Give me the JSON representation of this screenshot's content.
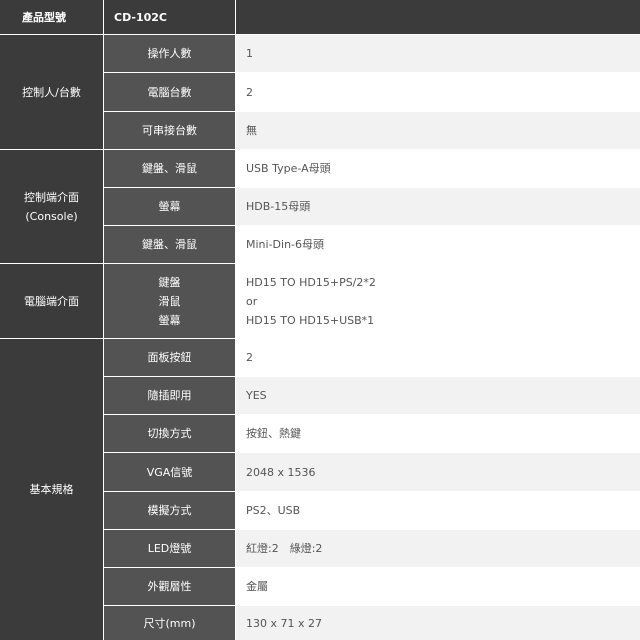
{
  "header": {
    "model_label": "產品型號",
    "model_value": "CD-102C"
  },
  "categories": [
    "控制人/台數",
    "控制端介面\n(Console)",
    "電腦端介面",
    "基本規格"
  ],
  "rows": [
    {
      "label": "操作人數",
      "value": "1"
    },
    {
      "label": "電腦台數",
      "value": "2"
    },
    {
      "label": "可串接台數",
      "value": "無"
    },
    {
      "label": "鍵盤、滑鼠",
      "value": "USB Type-A母頭"
    },
    {
      "label": "螢幕",
      "value": "HDB-15母頭"
    },
    {
      "label": "鍵盤、滑鼠",
      "value": "Mini-Din-6母頭"
    },
    {
      "label": "鍵盤\n滑鼠\n螢幕",
      "value": "HD15 TO HD15+PS/2*2\nor\nHD15 TO HD15+USB*1"
    },
    {
      "label": "面板按鈕",
      "value": "2"
    },
    {
      "label": "隨插即用",
      "value": "YES"
    },
    {
      "label": "切換方式",
      "value": "按鈕、熱鍵"
    },
    {
      "label": "VGA信號",
      "value": "2048 x 1536"
    },
    {
      "label": "模擬方式",
      "value": "PS2、USB"
    },
    {
      "label": "LED燈號",
      "value": "紅燈:2　綠燈:2"
    },
    {
      "label": "外觀層性",
      "value": "金屬"
    },
    {
      "label": "尺寸(mm)",
      "value": "130 x 71 x 27"
    }
  ]
}
